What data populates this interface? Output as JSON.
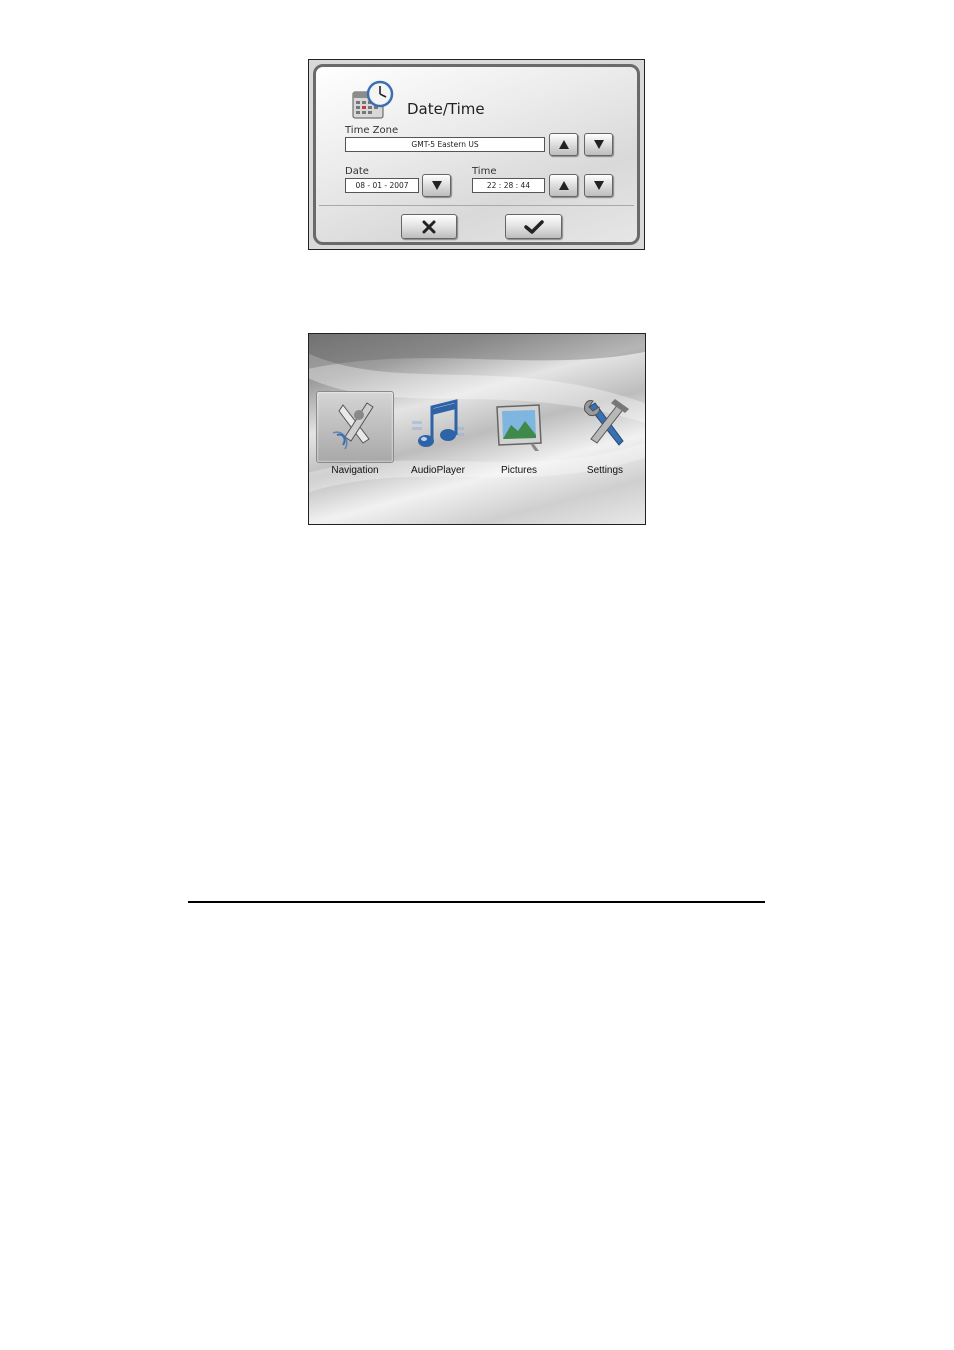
{
  "date_time_dialog": {
    "title": "Date/Time",
    "time_zone_label": "Time Zone",
    "time_zone_value": "GMT-5 Eastern US",
    "date_label": "Date",
    "date_value": "08 - 01 - 2007",
    "time_label": "Time",
    "time_value": "22 : 28 : 44",
    "icons": {
      "header": "clock-calendar-icon",
      "up": "arrow-up-icon",
      "down": "arrow-down-icon",
      "cancel": "x-icon",
      "ok": "checkmark-icon"
    }
  },
  "main_menu": {
    "items": [
      {
        "label": "Navigation",
        "icon": "navigation-icon",
        "selected": true
      },
      {
        "label": "AudioPlayer",
        "icon": "music-notes-icon",
        "selected": false
      },
      {
        "label": "Pictures",
        "icon": "picture-frame-icon",
        "selected": false
      },
      {
        "label": "Settings",
        "icon": "tools-icon",
        "selected": false
      }
    ]
  },
  "colors": {
    "accent_blue": "#3a6fb0",
    "frame_gray": "#6a6a6a"
  }
}
